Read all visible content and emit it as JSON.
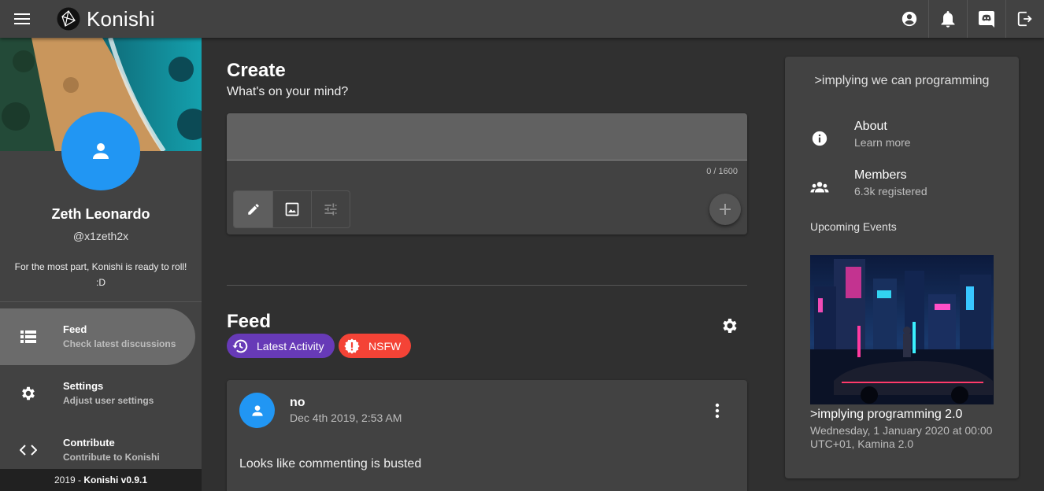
{
  "topbar": {
    "brand": "Konishi",
    "icons": [
      "menu-icon",
      "konishi-logo",
      "account-icon",
      "bell-icon",
      "discord-icon",
      "logout-icon"
    ]
  },
  "sidebar": {
    "user": {
      "name": "Zeth Leonardo",
      "handle": "@x1zeth2x",
      "bio": "For the most part, Konishi is ready to roll! :D"
    },
    "nav": [
      {
        "title": "Feed",
        "subtitle": "Check latest discussions",
        "icon": "list-icon",
        "active": true
      },
      {
        "title": "Settings",
        "subtitle": "Adjust user settings",
        "icon": "gear-icon",
        "active": false
      },
      {
        "title": "Contribute",
        "subtitle": "Contribute to Konishi",
        "icon": "code-icon",
        "active": false
      }
    ],
    "footer_year": "2019 - ",
    "footer_version": "Konishi v0.9.1"
  },
  "create": {
    "title": "Create",
    "subtitle": "What's on your mind?",
    "input_value": "",
    "counter": "0 / 1600",
    "tools": [
      "pencil-icon",
      "image-icon",
      "tune-icon"
    ],
    "submit_icon": "plus-icon"
  },
  "feed": {
    "title": "Feed",
    "chips": [
      {
        "label": "Latest Activity",
        "icon": "history-icon",
        "color": "#673ab7"
      },
      {
        "label": "NSFW",
        "icon": "alert-icon",
        "color": "#f44336"
      }
    ],
    "posts": [
      {
        "author": "no",
        "date": "Dec 4th 2019, 2:53 AM",
        "body": "Looks like commenting is busted"
      }
    ]
  },
  "community": {
    "title": ">implying we can programming",
    "items": [
      {
        "title": "About",
        "subtitle": "Learn more",
        "icon": "info-icon"
      },
      {
        "title": "Members",
        "subtitle": "6.3k registered",
        "icon": "members-icon"
      }
    ],
    "upcoming_label": "Upcoming Events",
    "event": {
      "title": ">implying programming 2.0",
      "when": "Wednesday, 1 January 2020 at 00:00 UTC+01, Kamina 2.0"
    }
  },
  "colors": {
    "background": "#303030",
    "surface": "#424242",
    "avatar_blue": "#2196f3",
    "chip_purple": "#673ab7",
    "chip_red": "#f44336"
  }
}
